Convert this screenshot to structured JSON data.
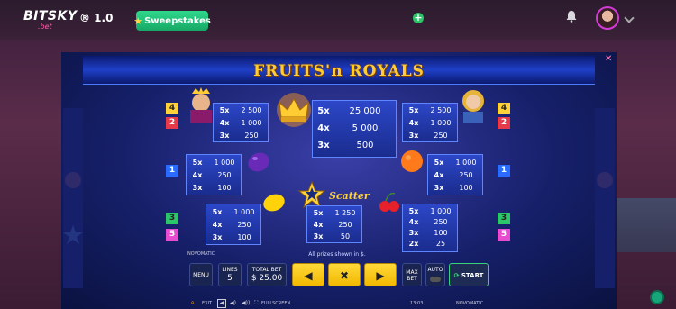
{
  "header": {
    "logo": "BITSKY",
    "logo_sub": ".bet",
    "version": "® 1.0",
    "sweepstakes_label": "Sweepstakes",
    "plus_label": "+"
  },
  "game": {
    "title": "FRUITS'n ROYALS",
    "close_label": "✕",
    "scatter_label": "Scatter",
    "prizes_note": "All prizes shown in $.",
    "provider_small": "NOVOMATIC",
    "side_badges": {
      "left": [
        "4",
        "2",
        "1",
        "3",
        "5"
      ],
      "right": [
        "4",
        "2",
        "1",
        "3",
        "5"
      ]
    },
    "paytables": {
      "king": [
        {
          "m": "5x",
          "v": "2 500"
        },
        {
          "m": "4x",
          "v": "1 000"
        },
        {
          "m": "3x",
          "v": "250"
        }
      ],
      "crown": [
        {
          "m": "5x",
          "v": "25 000"
        },
        {
          "m": "4x",
          "v": "5 000"
        },
        {
          "m": "3x",
          "v": "500"
        }
      ],
      "queen": [
        {
          "m": "5x",
          "v": "2 500"
        },
        {
          "m": "4x",
          "v": "1 000"
        },
        {
          "m": "3x",
          "v": "250"
        }
      ],
      "plum": [
        {
          "m": "5x",
          "v": "1 000"
        },
        {
          "m": "4x",
          "v": "250"
        },
        {
          "m": "3x",
          "v": "100"
        }
      ],
      "orange": [
        {
          "m": "5x",
          "v": "1 000"
        },
        {
          "m": "4x",
          "v": "250"
        },
        {
          "m": "3x",
          "v": "100"
        }
      ],
      "lemon": [
        {
          "m": "5x",
          "v": "1 000"
        },
        {
          "m": "4x",
          "v": "250"
        },
        {
          "m": "3x",
          "v": "100"
        }
      ],
      "scatter": [
        {
          "m": "5x",
          "v": "1 250"
        },
        {
          "m": "4x",
          "v": "250"
        },
        {
          "m": "3x",
          "v": "50"
        }
      ],
      "cherry": [
        {
          "m": "5x",
          "v": "1 000"
        },
        {
          "m": "4x",
          "v": "250"
        },
        {
          "m": "3x",
          "v": "100"
        },
        {
          "m": "2x",
          "v": "25"
        }
      ]
    }
  },
  "controls": {
    "menu": "MENU",
    "lines_label": "LINES",
    "lines_value": "5",
    "total_bet_label": "TOTAL BET",
    "total_bet_value": "$ 25.00",
    "prev": "◀",
    "close": "✖",
    "next": "▶",
    "max_bet": "MAX BET",
    "auto_label": "AUTO",
    "start": "START"
  },
  "bottom": {
    "exit": "EXIT",
    "fullscreen": "FULLSCREEN",
    "time": "13:03",
    "provider": "NOVOMATIC"
  },
  "colors": {
    "accent_green": "#2ec46a",
    "title_gold": "#ffcc33",
    "paybox_blue": "#2c47c8",
    "badge_yellow": "#ffd23a",
    "badge_red": "#e43a4a",
    "badge_blue": "#2a6cff",
    "badge_green": "#2ec46a",
    "badge_pink": "#e64bd0"
  }
}
